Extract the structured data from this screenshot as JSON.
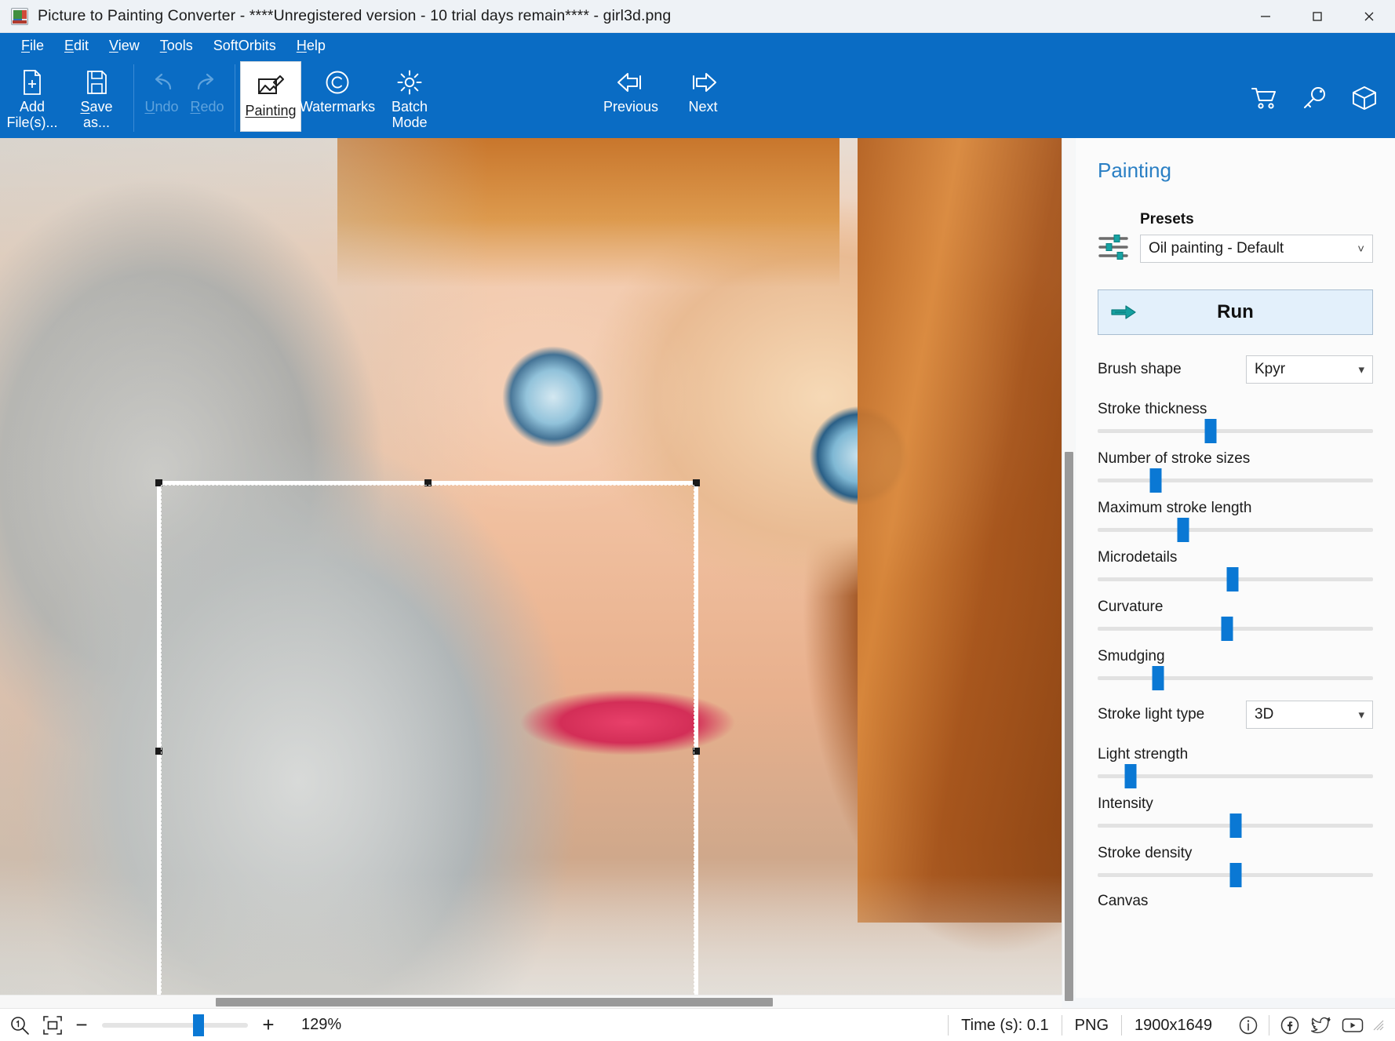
{
  "window": {
    "title": "Picture to Painting Converter - ****Unregistered version - 10 trial days remain**** - girl3d.png",
    "minimize_label": "minimize",
    "maximize_label": "maximize",
    "close_label": "close"
  },
  "menubar": {
    "items": [
      {
        "label": "File",
        "accel": "F"
      },
      {
        "label": "Edit",
        "accel": "E"
      },
      {
        "label": "View",
        "accel": "V"
      },
      {
        "label": "Tools",
        "accel": "T"
      },
      {
        "label": "SoftOrbits",
        "accel": ""
      },
      {
        "label": "Help",
        "accel": "H"
      }
    ]
  },
  "toolbar": {
    "add_files": "Add File(s)...",
    "add_line1": "Add",
    "add_line2": "File(s)...",
    "save_line1": "Save",
    "save_line2": "as...",
    "undo": "Undo",
    "redo": "Redo",
    "painting": "Painting",
    "watermarks": "Watermarks",
    "batch_line1": "Batch",
    "batch_line2": "Mode",
    "previous": "Previous",
    "next": "Next",
    "cart_icon": "cart-icon",
    "key_icon": "key-icon",
    "box_icon": "box-icon"
  },
  "panel": {
    "title": "Painting",
    "presets_label": "Presets",
    "preset_value": "Oil painting - Default",
    "run_label": "Run",
    "brush_shape_label": "Brush shape",
    "brush_shape_value": "Kpyr",
    "stroke_light_type_label": "Stroke light type",
    "stroke_light_type_value": "3D",
    "canvas_label": "Canvas",
    "accent_color": "#0a78d4",
    "sliders": [
      {
        "label": "Stroke thickness",
        "percent": 41
      },
      {
        "label": "Number of stroke sizes",
        "percent": 21
      },
      {
        "label": "Maximum stroke length",
        "percent": 31
      },
      {
        "label": "Microdetails",
        "percent": 49
      },
      {
        "label": "Curvature",
        "percent": 47
      },
      {
        "label": "Smudging",
        "percent": 22
      },
      {
        "label": "Light strength",
        "percent": 12
      },
      {
        "label": "Intensity",
        "percent": 50
      },
      {
        "label": "Stroke density",
        "percent": 50
      }
    ]
  },
  "statusbar": {
    "zoom_icon": "zoom-1to1-icon",
    "fit_icon": "fit-to-window-icon",
    "minus": "−",
    "plus": "+",
    "zoom_percent": "129%",
    "zoom_slider_percent": 66,
    "time": "Time (s): 0.1",
    "format": "PNG",
    "dimensions": "1900x1649",
    "info_icon": "info-icon",
    "facebook_icon": "facebook-icon",
    "twitter_icon": "twitter-icon",
    "youtube_icon": "youtube-icon"
  },
  "canvas": {
    "image_name": "girl3d.png",
    "selection": "crop-selection-rectangle"
  }
}
